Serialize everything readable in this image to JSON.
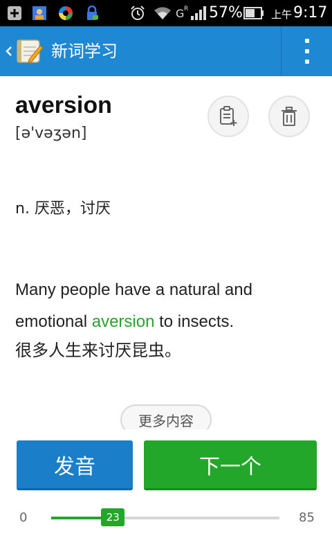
{
  "status_bar": {
    "battery_percent": "57%",
    "ampm": "上午",
    "time": "9:17",
    "network_label": "G",
    "roaming_label": "R",
    "icons": [
      "notification-plus-icon",
      "contacts-icon",
      "app-circle-icon",
      "lock-phone-icon",
      "alarm-icon",
      "wifi-icon",
      "signal-icon",
      "battery-icon"
    ]
  },
  "app_bar": {
    "title": "新词学习",
    "back_icon": "chevron-left-icon",
    "logo_icon": "notebook-pencil-icon",
    "menu_icon": "overflow-menu-icon"
  },
  "word": {
    "text": "aversion",
    "phonetic": "[ə'vəʒən]",
    "actions": {
      "add_note_icon": "add-note-icon",
      "delete_icon": "trash-icon"
    }
  },
  "definition": "n. 厌恶，讨厌",
  "example": {
    "before": "Many people have a natural and emotional ",
    "highlight": "aversion",
    "after": " to insects.",
    "translation": "很多人生来讨厌昆虫。"
  },
  "more_button": "更多内容",
  "buttons": {
    "pronounce": "发音",
    "next": "下一个"
  },
  "progress": {
    "min": "0",
    "max": "85",
    "current": "23",
    "current_value": 23,
    "max_value": 85
  },
  "colors": {
    "app_bar": "#1e88d2",
    "pronounce": "#1a7ec8",
    "next": "#22a72a",
    "highlight": "#29a32b"
  }
}
